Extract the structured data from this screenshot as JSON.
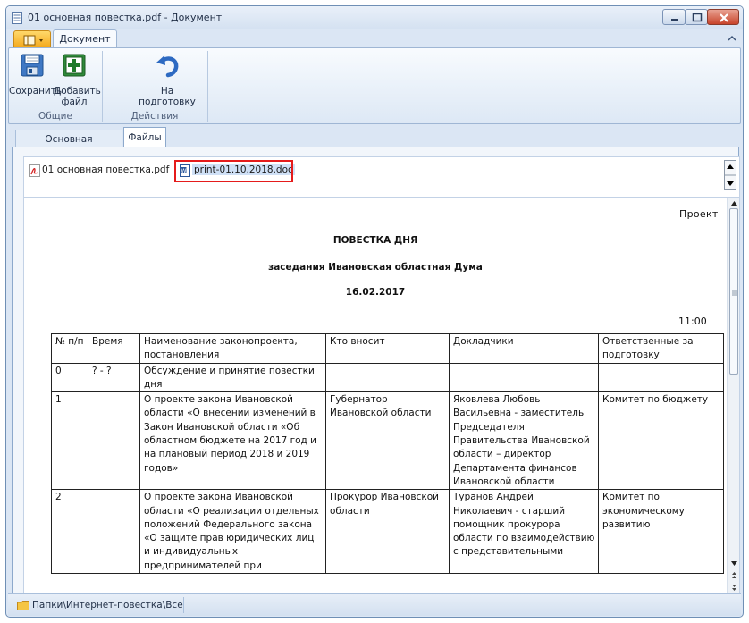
{
  "window": {
    "title": "01 основная повестка.pdf - Документ"
  },
  "ribbon": {
    "tab_label": "Документ",
    "buttons": {
      "save": "Сохранить",
      "add_file_line1": "Добавить",
      "add_file_line2": "файл",
      "to_prep": "На подготовку"
    },
    "groups": {
      "general": "Общие",
      "actions": "Действия"
    }
  },
  "tabs": {
    "main_info": "Основная информация",
    "files": "Файлы"
  },
  "files": [
    {
      "name": "01 основная повестка.pdf",
      "icon": "pdf-file-icon"
    },
    {
      "name": "print-01.10.2018.doc",
      "icon": "word-file-icon",
      "highlighted": true
    }
  ],
  "document": {
    "project": "Проект",
    "heading": "ПОВЕСТКА ДНЯ",
    "subheading": "заседания  Ивановская областная Дума",
    "date": "16.02.2017",
    "time": "11:00",
    "table": {
      "headers": [
        "№ п/п",
        "Время",
        "Наименование законопроекта, постановления",
        "Кто вносит",
        "Докладчики",
        "Ответственные за подготовку"
      ],
      "rows": [
        {
          "num": "0",
          "time": "? - ?",
          "title": "Обсуждение и принятие повестки дня",
          "by": "",
          "speakers": "",
          "responsible": ""
        },
        {
          "num": "1",
          "time": "",
          "title": "О проекте закона Ивановской области «О внесении изменений в Закон Ивановской области «Об областном бюджете на 2017 год и на плановый период 2018 и 2019 годов»",
          "by": "Губернатор Ивановской области",
          "speakers": "Яковлева Любовь Васильевна - заместитель Председателя Правительства Ивановской области – директор Департамента финансов Ивановской области",
          "responsible": "Комитет по бюджету"
        },
        {
          "num": "2",
          "time": "",
          "title": "О проекте закона Ивановской области «О реализации отдельных положений Федерального закона «О защите прав юридических лиц и индивидуальных предпринимателей при",
          "by": "Прокурор Ивановской области",
          "speakers": "Туранов Андрей Николаевич - старший помощник прокурора области по взаимодействию с представительными",
          "responsible": "Комитет по экономическому развитию"
        }
      ]
    }
  },
  "statusbar": {
    "path": "Папки\\Интернет-повестка\\Все"
  },
  "colors": {
    "highlight_border": "#e51b1b",
    "window_frame": "#dbe6f4",
    "app_button": "#f3a618",
    "close_button": "#c8442b"
  }
}
